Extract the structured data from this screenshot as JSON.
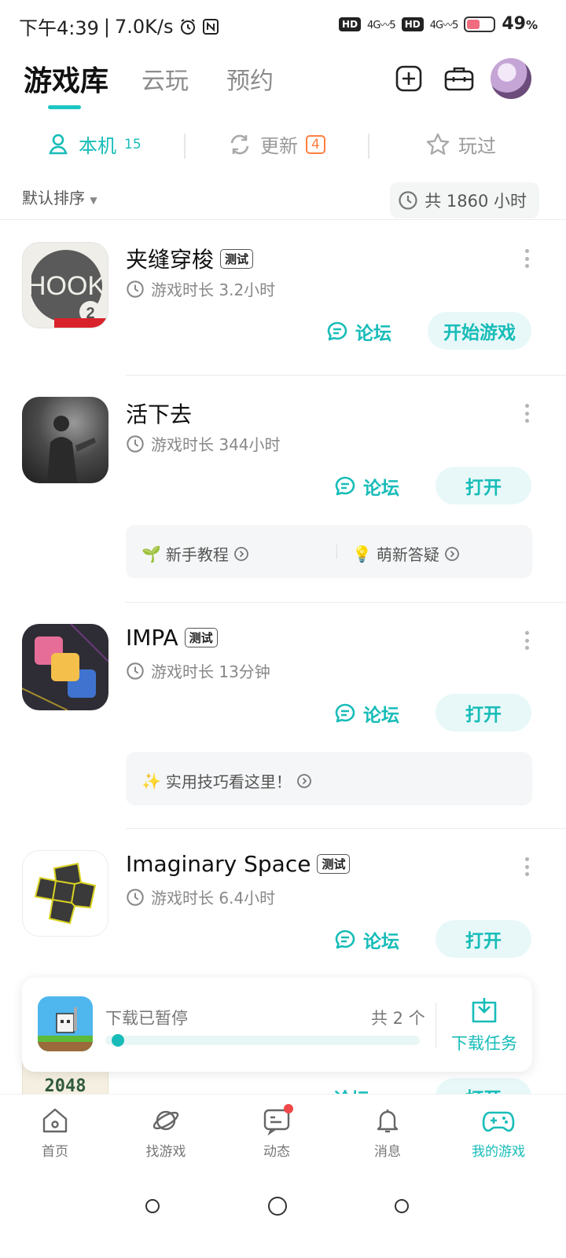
{
  "status_bar": {
    "time": "下午4:39",
    "speed": "7.0K/s",
    "battery_pct": "49",
    "battery_unit": "%",
    "hd": "HD",
    "signal1": "4G",
    "signal2": "4G"
  },
  "header": {
    "tabs": [
      {
        "label": "游戏库"
      },
      {
        "label": "云玩"
      },
      {
        "label": "预约"
      }
    ]
  },
  "subtabs": {
    "local": {
      "label": "本机",
      "count": "15"
    },
    "update": {
      "label": "更新",
      "count": "4"
    },
    "played": {
      "label": "玩过"
    }
  },
  "sort": {
    "label": "默认排序",
    "total_hours": "共 1860 小时"
  },
  "games": [
    {
      "title": "夹缝穿梭",
      "tag": "测试",
      "time": "游戏时长 3.2小时",
      "forum": "论坛",
      "action": "开始游戏"
    },
    {
      "title": "活下去",
      "tag": "",
      "time": "游戏时长 344小时",
      "forum": "论坛",
      "action": "打开",
      "tips": [
        {
          "emoji": "🌱",
          "text": "新手教程"
        },
        {
          "emoji": "💡",
          "text": "萌新答疑"
        }
      ]
    },
    {
      "title": "IMPA",
      "tag": "测试",
      "time": "游戏时长 13分钟",
      "forum": "论坛",
      "action": "打开",
      "tips": [
        {
          "emoji": "✨",
          "text": "实用技巧看这里！"
        }
      ]
    },
    {
      "title": "Imaginary Space",
      "tag": "测试",
      "time": "游戏时长 6.4小时",
      "forum": "论坛",
      "action": "打开"
    }
  ],
  "partial_game": {
    "icon_text": "2048",
    "forum": "论坛",
    "action": "打开"
  },
  "download": {
    "status": "下载已暂停",
    "count": "共 2 个",
    "task_label": "下载任务",
    "progress": 0.02
  },
  "bottom_nav": [
    {
      "label": "首页"
    },
    {
      "label": "找游戏"
    },
    {
      "label": "动态"
    },
    {
      "label": "消息"
    },
    {
      "label": "我的游戏"
    }
  ],
  "colors": {
    "accent": "#17bcb8",
    "update_badge": "#ff7f3f",
    "notify_dot": "#f04848"
  }
}
